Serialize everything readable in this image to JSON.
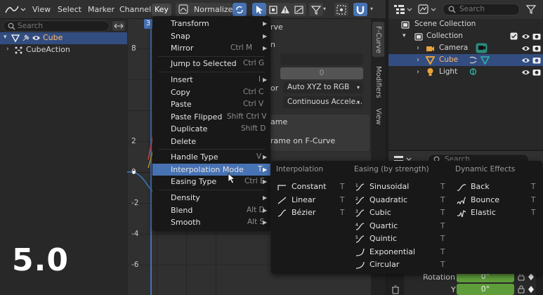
{
  "header": {
    "menus": [
      "View",
      "Select",
      "Marker",
      "Channel",
      "Key"
    ],
    "normalize_label": "Normalize"
  },
  "channels": {
    "search_placeholder": "Search",
    "rows": [
      {
        "label": "Cube"
      },
      {
        "label": "CubeAction"
      }
    ]
  },
  "graph": {
    "frame_marker": "3",
    "y_labels": [
      "8",
      "2",
      "0",
      "-2",
      "-4",
      "-6"
    ]
  },
  "sidepanel": {
    "title_fragment": "rve",
    "fragment_n": "n",
    "value": "0",
    "label_or": "or",
    "color_mode": "Auto XYZ to RGB",
    "auto_handle": "Continuous Accele...",
    "section_fragment": "ame",
    "frame_button": "rame on F-Curve",
    "tabs": [
      "F-Curve",
      "Modifiers",
      "View"
    ]
  },
  "key_menu": {
    "items": [
      {
        "label": "Transform",
        "shortcut": "",
        "submenu": true
      },
      {
        "label": "Snap",
        "shortcut": "",
        "submenu": true
      },
      {
        "label": "Mirror",
        "shortcut": "Ctrl M",
        "submenu": true
      },
      {
        "label": "Jump to Selected",
        "shortcut": "Ctrl G",
        "submenu": false
      },
      {
        "label": "Insert",
        "shortcut": "I",
        "submenu": true
      },
      {
        "label": "Copy",
        "shortcut": "Ctrl C",
        "submenu": false
      },
      {
        "label": "Paste",
        "shortcut": "Ctrl V",
        "submenu": false
      },
      {
        "label": "Paste Flipped",
        "shortcut": "Shift Ctrl V",
        "submenu": false
      },
      {
        "label": "Duplicate",
        "shortcut": "Shift D",
        "submenu": false
      },
      {
        "label": "Delete",
        "shortcut": "",
        "submenu": false
      },
      {
        "label": "Handle Type",
        "shortcut": "V",
        "submenu": true
      },
      {
        "label": "Interpolation Mode",
        "shortcut": "T",
        "submenu": true
      },
      {
        "label": "Easing Type",
        "shortcut": "Ctrl E",
        "submenu": true
      },
      {
        "label": "Density",
        "shortcut": "",
        "submenu": true
      },
      {
        "label": "Blend",
        "shortcut": "Alt D",
        "submenu": true
      },
      {
        "label": "Smooth",
        "shortcut": "Alt S",
        "submenu": true
      }
    ]
  },
  "interp_menu": {
    "col1_title": "Interpolation",
    "col2_title": "Easing (by strength)",
    "col3_title": "Dynamic Effects",
    "interpolation": [
      {
        "label": "Constant",
        "shortcut": "T"
      },
      {
        "label": "Linear",
        "shortcut": "T"
      },
      {
        "label": "Bézier",
        "shortcut": "T"
      }
    ],
    "easing": [
      {
        "label": "Sinusoidal",
        "shortcut": "T"
      },
      {
        "label": "Quadratic",
        "shortcut": "T"
      },
      {
        "label": "Cubic",
        "shortcut": "T"
      },
      {
        "label": "Quartic",
        "shortcut": "T"
      },
      {
        "label": "Quintic",
        "shortcut": "T"
      },
      {
        "label": "Exponential",
        "shortcut": "T"
      },
      {
        "label": "Circular",
        "shortcut": "T"
      }
    ],
    "dynamic": [
      {
        "label": "Back",
        "shortcut": "T"
      },
      {
        "label": "Bounce",
        "shortcut": "T"
      },
      {
        "label": "Elastic",
        "shortcut": "T"
      }
    ]
  },
  "outliner": {
    "search_placeholder": "Search",
    "scene_collection": "Scene Collection",
    "rows": [
      {
        "label": "Collection"
      },
      {
        "label": "Camera"
      },
      {
        "label": "Cube"
      },
      {
        "label": "Light"
      }
    ]
  },
  "properties": {
    "search_placeholder": "Search",
    "rotation_x_label": "Rotation X",
    "rotation_x_value": "0°",
    "y_label": "Y",
    "y_value": "0°"
  },
  "version_label": "5.0",
  "colors": {
    "accent": "#4772b3",
    "selected_row": "#334d80",
    "keyed_field": "#5f9d3a",
    "camera_icon": "#e8a33c",
    "mesh_icon": "#e8a33c",
    "constraint_icon": "#2fb9a8"
  }
}
